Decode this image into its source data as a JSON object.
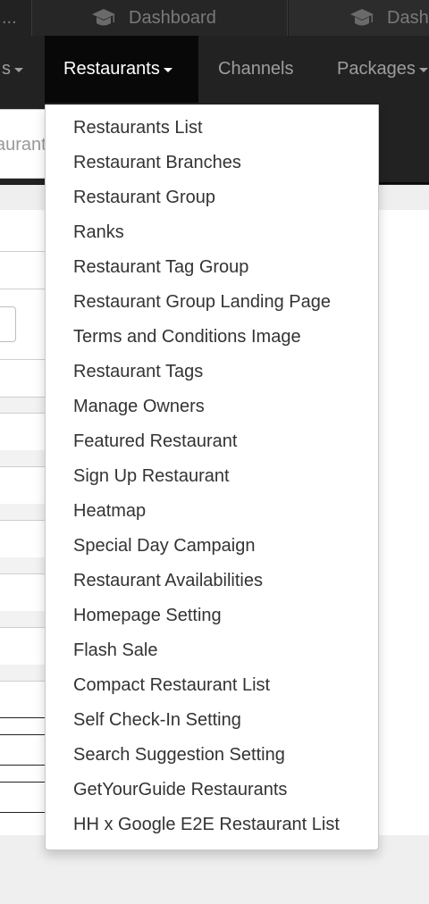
{
  "browser_tabs": [
    {
      "label": "..."
    },
    {
      "label": "Dashboard",
      "icon": "graduation-cap-icon"
    },
    {
      "label": "Dash",
      "icon": "graduation-cap-icon"
    }
  ],
  "navbar": {
    "items": [
      {
        "label": "s",
        "has_caret": true,
        "active": false
      },
      {
        "label": "Restaurants",
        "has_caret": true,
        "active": true
      },
      {
        "label": "Channels",
        "has_caret": false,
        "active": false
      },
      {
        "label": "Packages",
        "has_caret": true,
        "active": false
      }
    ]
  },
  "search": {
    "value": "aurant"
  },
  "dropdown": {
    "items": [
      "Restaurants List",
      "Restaurant Branches",
      "Restaurant Group",
      "Ranks",
      "Restaurant Tag Group",
      "Restaurant Group Landing Page",
      "Terms and Conditions Image",
      "Restaurant Tags",
      "Manage Owners",
      "Featured Restaurant",
      "Sign Up Restaurant",
      "Heatmap",
      "Special Day Campaign",
      "Restaurant Availabilities",
      "Homepage Setting",
      "Flash Sale",
      "Compact Restaurant List",
      "Self Check-In Setting",
      "Search Suggestion Setting",
      "GetYourGuide Restaurants",
      "HH x Google E2E Restaurant List"
    ]
  },
  "colors": {
    "navbar_bg": "#222222",
    "navbar_active_bg": "#080808",
    "nav_text": "#9d9d9d",
    "nav_active_text": "#ffffff",
    "menu_text": "#333333"
  }
}
